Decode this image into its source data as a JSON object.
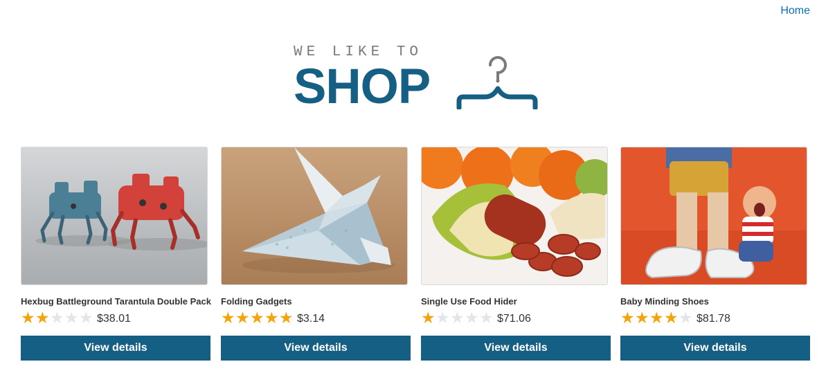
{
  "nav": {
    "home_label": "Home"
  },
  "logo": {
    "tagline": "WE LIKE TO",
    "wordmark": "SHOP",
    "icon": "hanger-icon",
    "color": "#155f84"
  },
  "products": [
    {
      "name": "Hexbug Battleground Tarantula Double Pack",
      "rating": 2,
      "rating_max": 5,
      "price": "$38.01",
      "button_label": "View details",
      "image": "robot-spiders-image"
    },
    {
      "name": "Folding Gadgets",
      "rating": 5,
      "rating_max": 5,
      "price": "$3.14",
      "button_label": "View details",
      "image": "origami-bird-image"
    },
    {
      "name": "Single Use Food Hider",
      "rating": 1,
      "rating_max": 5,
      "price": "$71.06",
      "button_label": "View details",
      "image": "banana-sausage-image"
    },
    {
      "name": "Baby Minding Shoes",
      "rating": 4,
      "rating_max": 5,
      "price": "$81.78",
      "button_label": "View details",
      "image": "toy-figure-shoes-image"
    }
  ],
  "colors": {
    "accent": "#155f84",
    "star_on": "#f5a30b",
    "star_off": "#e3e6e8",
    "link": "#0a6eb4"
  }
}
